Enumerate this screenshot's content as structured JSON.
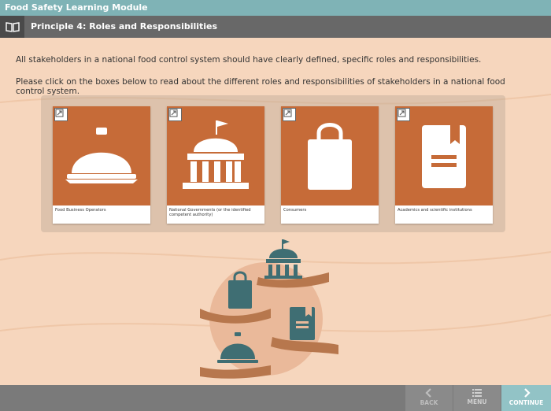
{
  "app": {
    "title": "Food Safety Learning Module"
  },
  "header": {
    "page_title": "Principle 4: Roles and Responsibilities"
  },
  "intro": {
    "line1": "All stakeholders in a national food control system should have clearly defined, specific roles and responsibilities.",
    "line2": "Please click on the boxes below to read about the different roles and responsibilities of stakeholders in a national food control system."
  },
  "cards": [
    {
      "label": "Food Business Operators",
      "icon": "food-cloche-icon"
    },
    {
      "label": "National Governments (or the identified competent authority)",
      "icon": "government-building-icon"
    },
    {
      "label": "Consumers",
      "icon": "shopping-bag-icon"
    },
    {
      "label": "Academics and scientific institutions",
      "icon": "book-icon"
    }
  ],
  "footer": {
    "back": "BACK",
    "menu": "MENU",
    "continue": "CONTINUE"
  },
  "colors": {
    "title_bar": "#7fb3b6",
    "sub_bar": "#686868",
    "card_bg": "#c66b38",
    "icon_teal": "#3f6e73",
    "background": "#f6d6bd"
  }
}
